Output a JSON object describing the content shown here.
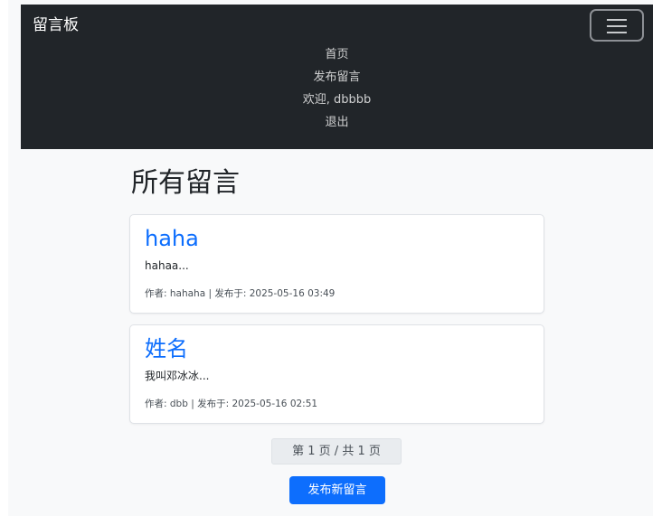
{
  "navbar": {
    "brand": "留言板",
    "toggler_icon": "hamburger-menu-icon",
    "links": [
      "首页",
      "发布留言",
      "欢迎, dbbbb",
      "退出"
    ]
  },
  "main": {
    "title": "所有留言",
    "posts": [
      {
        "title": "haha",
        "excerpt": "hahaa...",
        "meta": "作者: hahaha | 发布于: 2025-05-16 03:49"
      },
      {
        "title": "姓名",
        "excerpt": "我叫邓冰冰...",
        "meta": "作者: dbb | 发布于: 2025-05-16 02:51"
      }
    ],
    "pagination": "第 1 页 / 共 1 页",
    "new_post_button": "发布新留言"
  },
  "colors": {
    "navbar_bg": "#212529",
    "link_blue": "#0d6efd",
    "primary_button": "#0d6efd",
    "page_bg": "#f8f9fa"
  }
}
